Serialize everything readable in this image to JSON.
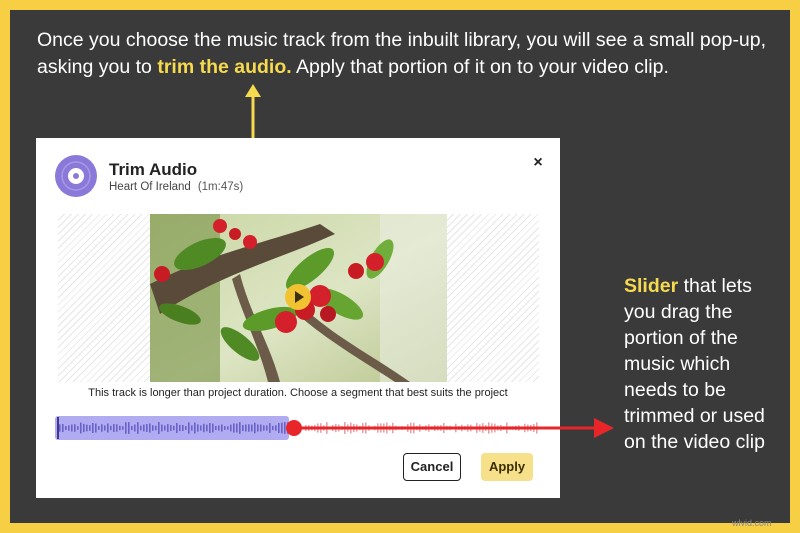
{
  "annotation": {
    "headline_part1": "Once you choose the music track from the inbuilt library, you will see a small pop-up, asking you to ",
    "headline_highlight": "trim the audio.",
    "headline_part2": " Apply that portion of it on to your video clip.",
    "side_highlight": "Slider",
    "side_text": " that lets you drag the portion of the music which needs to be trimmed or used on the video clip"
  },
  "dialog": {
    "title": "Trim Audio",
    "track_name": "Heart Of Ireland",
    "track_duration": "(1m:47s)",
    "close_label": "×",
    "message": "This track is longer than project duration. Choose a segment that best suits the project",
    "cancel_label": "Cancel",
    "apply_label": "Apply",
    "selection_fraction": 0.48
  },
  "watermark": "wlvid.com",
  "colors": {
    "background": "#3a3a3a",
    "border": "#f7cf45",
    "highlight": "#f5d94f",
    "selection": "#b1acf2",
    "slider_handle": "#e8262a",
    "apply_button": "#f7e08a"
  },
  "icons": [
    "music-disc-icon",
    "close-icon",
    "play-icon",
    "arrow-up-icon",
    "arrow-right-icon"
  ]
}
